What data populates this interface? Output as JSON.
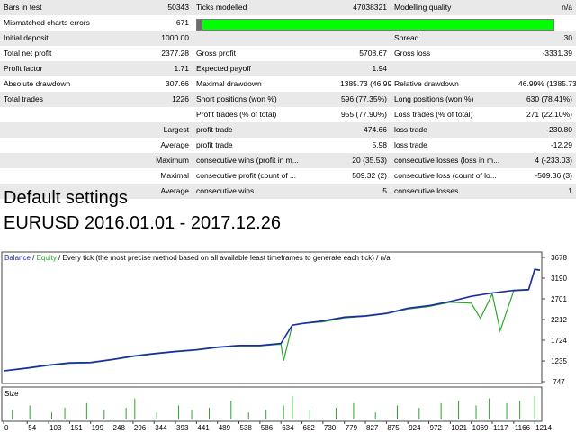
{
  "stats_rows": [
    [
      "Bars in test",
      "50343",
      "Ticks modelled",
      "47038321",
      "Modelling quality",
      "n/a"
    ],
    [
      "Mismatched charts errors",
      "671",
      "",
      "",
      "",
      ""
    ],
    [
      "Initial deposit",
      "1000.00",
      "",
      "",
      "Spread",
      "30"
    ],
    [
      "Total net profit",
      "2377.28",
      "Gross profit",
      "5708.67",
      "Gross loss",
      "-3331.39"
    ],
    [
      "Profit factor",
      "1.71",
      "Expected payoff",
      "1.94",
      "",
      ""
    ],
    [
      "Absolute drawdown",
      "307.66",
      "Maximal drawdown",
      "1385.73 (46.99%)",
      "Relative drawdown",
      "46.99% (1385.73)"
    ],
    [
      "Total trades",
      "1226",
      "Short positions (won %)",
      "596 (77.35%)",
      "Long positions (won %)",
      "630 (78.41%)"
    ],
    [
      "",
      "",
      "Profit trades (% of total)",
      "955 (77.90%)",
      "Loss trades (% of total)",
      "271 (22.10%)"
    ],
    [
      "",
      "Largest",
      "profit trade",
      "474.66",
      "loss trade",
      "-230.80"
    ],
    [
      "",
      "Average",
      "profit trade",
      "5.98",
      "loss trade",
      "-12.29"
    ],
    [
      "",
      "Maximum",
      "consecutive wins (profit in m...",
      "20 (35.53)",
      "consecutive losses (loss in m...",
      "4 (-233.03)"
    ],
    [
      "",
      "Maximal",
      "consecutive profit (count of ...",
      "509.32 (2)",
      "consecutive loss (count of lo...",
      "-509.36 (3)"
    ],
    [
      "",
      "Average",
      "consecutive wins",
      "5",
      "consecutive losses",
      "1"
    ]
  ],
  "modelling_quality_bar": 1.0,
  "heading_line1": "Default settings",
  "heading_line2": "EURUSD 2016.01.01 - 2017.12.26",
  "chart_legend": {
    "balance": "Balance",
    "sep1": " / ",
    "equity": "Equity",
    "rest": " / Every tick (the most precise method based on all available least timeframes to generate each tick)  /  n/a"
  },
  "size_label": "Size",
  "colors": {
    "balance": "#1a2aa8",
    "equity": "#2ca52c",
    "size_bars": "#2ca52c",
    "quality_bar": "#00ff00"
  },
  "chart_data": {
    "type": "line",
    "x_ticks": [
      "0",
      "54",
      "103",
      "151",
      "199",
      "248",
      "296",
      "344",
      "393",
      "441",
      "489",
      "538",
      "586",
      "634",
      "682",
      "730",
      "779",
      "827",
      "875",
      "924",
      "972",
      "1021",
      "1069",
      "1117",
      "1166",
      "1214"
    ],
    "y_ticks": [
      3678,
      3190,
      2701,
      2212,
      1724,
      1235,
      747
    ],
    "x_range": [
      0,
      1226
    ],
    "ylim": [
      747,
      3678
    ],
    "series": [
      {
        "name": "Balance",
        "x": [
          0,
          54,
          103,
          151,
          199,
          248,
          296,
          344,
          393,
          441,
          489,
          538,
          586,
          634,
          660,
          682,
          730,
          779,
          827,
          875,
          924,
          972,
          1021,
          1069,
          1117,
          1166,
          1200,
          1214,
          1226
        ],
        "values": [
          1000,
          1070,
          1140,
          1190,
          1200,
          1270,
          1350,
          1410,
          1460,
          1500,
          1560,
          1600,
          1600,
          1650,
          2080,
          2120,
          2180,
          2270,
          2300,
          2360,
          2480,
          2540,
          2640,
          2760,
          2840,
          2900,
          2920,
          3400,
          3380
        ]
      },
      {
        "name": "Equity",
        "x": [
          0,
          54,
          103,
          151,
          199,
          248,
          296,
          344,
          393,
          441,
          489,
          538,
          586,
          634,
          640,
          660,
          682,
          730,
          779,
          827,
          875,
          924,
          972,
          1021,
          1069,
          1090,
          1117,
          1135,
          1166,
          1200,
          1214,
          1226
        ],
        "values": [
          1000,
          1060,
          1130,
          1180,
          1190,
          1260,
          1340,
          1400,
          1450,
          1490,
          1550,
          1590,
          1590,
          1630,
          1240,
          2080,
          2120,
          2160,
          2250,
          2290,
          2350,
          2460,
          2520,
          2620,
          2600,
          2240,
          2820,
          1950,
          2890,
          2910,
          3390,
          3370
        ]
      }
    ],
    "size_bars": {
      "x": [
        20,
        60,
        110,
        140,
        190,
        230,
        280,
        300,
        350,
        400,
        430,
        470,
        520,
        560,
        600,
        640,
        660,
        700,
        760,
        800,
        850,
        900,
        950,
        1000,
        1040,
        1080,
        1110,
        1150,
        1180,
        1214
      ],
      "values": [
        0.4,
        0.6,
        0.3,
        0.5,
        0.7,
        0.4,
        0.5,
        0.9,
        0.3,
        0.6,
        0.4,
        0.5,
        0.8,
        0.3,
        0.4,
        0.6,
        1.0,
        0.4,
        0.5,
        0.7,
        0.3,
        0.6,
        0.5,
        0.7,
        0.8,
        0.6,
        0.9,
        0.7,
        0.8,
        1.0
      ]
    }
  }
}
